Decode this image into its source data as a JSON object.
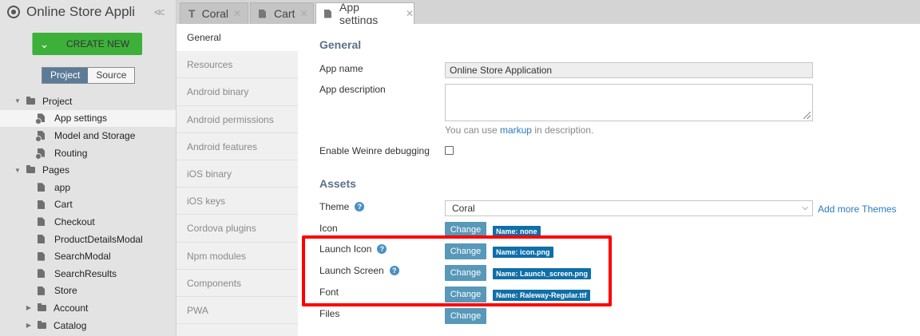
{
  "app": {
    "title": "Online Store Appli",
    "collapse_icon": "double-chevron-left-icon"
  },
  "create_button": {
    "label": "CREATE NEW"
  },
  "view_toggle": {
    "project": "Project",
    "source": "Source"
  },
  "tree": {
    "items": [
      {
        "label": "Project",
        "type": "folder",
        "expanded": true
      },
      {
        "label": "App settings",
        "type": "settings",
        "selected": true
      },
      {
        "label": "Model and Storage",
        "type": "settings"
      },
      {
        "label": "Routing",
        "type": "settings"
      },
      {
        "label": "Pages",
        "type": "folder",
        "expanded": true
      },
      {
        "label": "app",
        "type": "page"
      },
      {
        "label": "Cart",
        "type": "page"
      },
      {
        "label": "Checkout",
        "type": "page"
      },
      {
        "label": "ProductDetailsModal",
        "type": "page"
      },
      {
        "label": "SearchModal",
        "type": "page"
      },
      {
        "label": "SearchResults",
        "type": "page"
      },
      {
        "label": "Store",
        "type": "page"
      },
      {
        "label": "Account",
        "type": "folder",
        "expanded": false
      },
      {
        "label": "Catalog",
        "type": "folder",
        "expanded": false
      }
    ]
  },
  "tabs": [
    {
      "label": "Coral",
      "icon": "T",
      "active": false
    },
    {
      "label": "Cart",
      "icon": "file",
      "active": false
    },
    {
      "label": "App settings",
      "icon": "settings-file",
      "active": true
    }
  ],
  "settings_nav": [
    "General",
    "Resources",
    "Android binary",
    "Android permissions",
    "Android features",
    "iOS binary",
    "iOS keys",
    "Cordova plugins",
    "Npm modules",
    "Components",
    "PWA"
  ],
  "general": {
    "title": "General",
    "app_name_label": "App name",
    "app_name_value": "Online Store Application",
    "app_description_label": "App description",
    "hint_prefix": "You can use",
    "hint_link": "markup",
    "hint_suffix": "in description.",
    "weinre_label": "Enable Weinre debugging"
  },
  "assets": {
    "title": "Assets",
    "theme_label": "Theme",
    "theme_value": "Coral",
    "add_themes": "Add more Themes",
    "change_label": "Change",
    "icon_label": "Icon",
    "icon_tag": "Name: none",
    "launch_icon_label": "Launch Icon",
    "launch_icon_tag": "Name: icon.png",
    "launch_screen_label": "Launch Screen",
    "launch_screen_tag": "Name: Launch_screen.png",
    "font_label": "Font",
    "font_tag": "Name: Raleway-Regular.ttf",
    "files_label": "Files"
  },
  "colors": {
    "accent_green": "#3db03a",
    "button_blue": "#5898b8",
    "tag_blue": "#0f6fa8",
    "highlight_red": "#ff0000"
  }
}
